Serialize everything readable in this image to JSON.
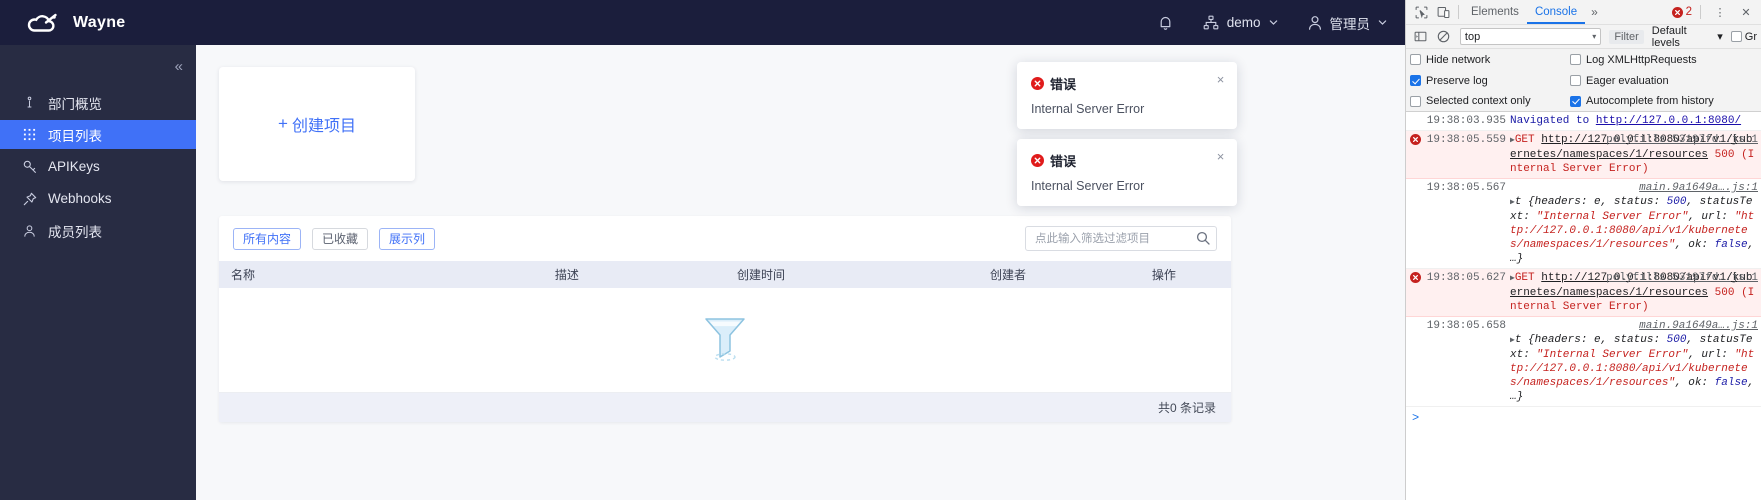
{
  "app": {
    "brand": {
      "name": "Wayne",
      "logo_icon": "cloud-logo-icon"
    },
    "nav": {
      "bell_icon": "bell-icon",
      "org": {
        "label": "demo",
        "icon": "sitemap-icon",
        "caret": "chevron-down-icon"
      },
      "user": {
        "label": "管理员",
        "icon": "user-icon",
        "caret": "chevron-down-icon"
      }
    },
    "sidebar": {
      "collapse_label": "«",
      "items": [
        {
          "label": "部门概览",
          "icon": "info-icon",
          "active": false
        },
        {
          "label": "项目列表",
          "icon": "grid-icon",
          "active": true
        },
        {
          "label": "APIKeys",
          "icon": "key-icon",
          "active": false
        },
        {
          "label": "Webhooks",
          "icon": "pin-icon",
          "active": false
        },
        {
          "label": "成员列表",
          "icon": "user-icon",
          "active": false
        }
      ]
    },
    "create_card": {
      "plus": "+",
      "label": "创建项目"
    },
    "toolbar": {
      "buttons": [
        {
          "label": "所有内容",
          "style": "primary"
        },
        {
          "label": "已收藏",
          "style": "plain"
        },
        {
          "label": "展示列",
          "style": "primary"
        }
      ],
      "search": {
        "value": "",
        "placeholder": "点此输入筛选过滤项目",
        "icon": "search-icon"
      }
    },
    "table": {
      "columns": [
        "名称",
        "描述",
        "创建时间",
        "创建者",
        "操作"
      ],
      "rows": [],
      "empty_icon": "funnel-empty-icon",
      "footer_count": "共0 条记录"
    },
    "toasts": [
      {
        "icon": "error-circle-icon",
        "title": "错误",
        "message": "Internal Server Error",
        "close": "×"
      },
      {
        "icon": "error-circle-icon",
        "title": "错误",
        "message": "Internal Server Error",
        "close": "×"
      }
    ]
  },
  "devtools": {
    "toolbar": {
      "inspect_icon": "inspect-element-icon",
      "device_icon": "device-toolbar-icon",
      "tabs": [
        {
          "label": "Elements",
          "active": false
        },
        {
          "label": "Console",
          "active": true
        }
      ],
      "more_tabs": "»",
      "error_count": "2",
      "kebab": "⋮",
      "close": "✕"
    },
    "filterbar": {
      "sidebar_icon": "console-sidebar-icon",
      "clear_icon": "clear-console-icon",
      "context": "top",
      "context_caret": "▾",
      "filter_placeholder": "Filter",
      "levels_label": "Default levels",
      "levels_caret": "▾",
      "group_similar": {
        "label": "Gr",
        "checked": false
      }
    },
    "options": [
      {
        "label": "Hide network",
        "checked": false
      },
      {
        "label": "Log XMLHttpRequests",
        "checked": false
      },
      {
        "label": "Preserve log",
        "checked": true
      },
      {
        "label": "Eager evaluation",
        "checked": false
      },
      {
        "label": "Selected context only",
        "checked": false
      },
      {
        "label": "Autocomplete from history",
        "checked": true
      }
    ],
    "logs": [
      {
        "kind": "info",
        "timestamp": "19:38:03.935",
        "prefix": "Navigated to ",
        "url": "http://127.0.0.1:8080/",
        "source": ""
      },
      {
        "kind": "error",
        "timestamp": "19:38:05.559",
        "method": "GET",
        "url": "http://127.0.0.1:8080/api/v1/kubernetes/namespaces/1/resources",
        "status": "500",
        "status_text": "(Internal Server Error)",
        "source": "polyfills.53197fd….js:1"
      },
      {
        "kind": "object",
        "timestamp": "19:38:05.567",
        "text_1": "t {headers: e, status: ",
        "status": "500",
        "text_2": ", statusText: ",
        "status_text": "\"Internal Server Error\"",
        "text_3": ", url: ",
        "url_text": "\"http://127.0.0.1:8080/api/v1/kubernetes/namespaces/1/resources\"",
        "text_4": ", ok: ",
        "ok": "false",
        "text_5": ", …}",
        "source": "main.9a1649a….js:1"
      },
      {
        "kind": "error",
        "timestamp": "19:38:05.627",
        "method": "GET",
        "url": "http://127.0.0.1:8080/api/v1/kubernetes/namespaces/1/resources",
        "status": "500",
        "status_text": "(Internal Server Error)",
        "source": "polyfills.53197fd….js:1"
      },
      {
        "kind": "object",
        "timestamp": "19:38:05.658",
        "text_1": "t {headers: e, status: ",
        "status": "500",
        "text_2": ", statusText: ",
        "status_text": "\"Internal Server Error\"",
        "text_3": ", url: ",
        "url_text": "\"http://127.0.0.1:8080/api/v1/kubernetes/namespaces/1/resources\"",
        "text_4": ", ok: ",
        "ok": "false",
        "text_5": ", …}",
        "source": "main.9a1649a….js:1"
      }
    ],
    "prompt": ">"
  },
  "colors": {
    "nav_bg": "#1b1e3c",
    "sidebar_bg": "#282c43",
    "accent": "#4071f7",
    "error": "#c5221f",
    "devtools_link": "#1a0dab"
  }
}
